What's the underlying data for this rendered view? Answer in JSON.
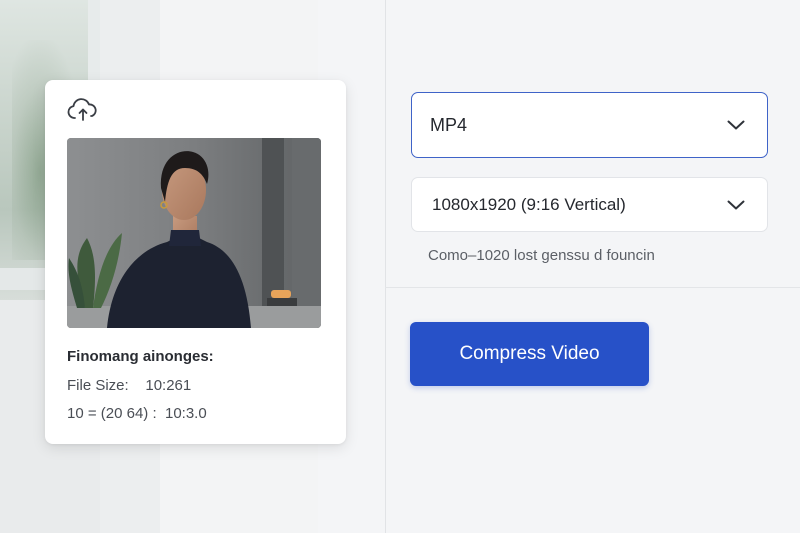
{
  "preview": {
    "info_title": "Finomang ainonges:",
    "file_size_label": "File Size:",
    "file_size_value": "10:261",
    "dimension_line": "10 = (20 64) :  10:3.0"
  },
  "format_select": {
    "selected": "MP4"
  },
  "resolution_select": {
    "selected": "1080x1920 (9:16 Vertical)"
  },
  "hint": "Como–1020 lost genssu d founcin",
  "compress_button": {
    "label": "Compress Video"
  },
  "colors": {
    "accent": "#2751c8",
    "focus_border": "#3f63c8"
  },
  "icons": {
    "upload": "cloud-upload-icon",
    "dropdown": "chevron-down-icon"
  }
}
